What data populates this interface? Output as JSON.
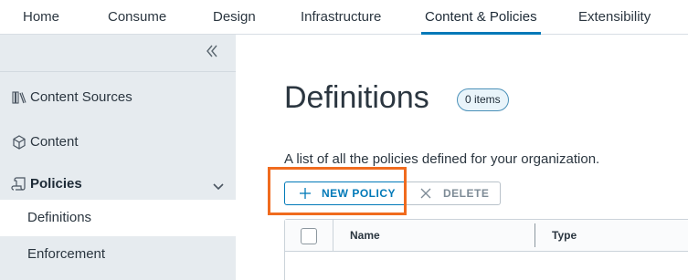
{
  "topnav": {
    "tabs": [
      {
        "label": "Home"
      },
      {
        "label": "Consume"
      },
      {
        "label": "Design"
      },
      {
        "label": "Infrastructure"
      },
      {
        "label": "Content & Policies"
      },
      {
        "label": "Extensibility"
      }
    ],
    "active_tab": "Content & Policies",
    "accent_color": "#0079b8"
  },
  "sidebar": {
    "items": [
      {
        "label": "Content Sources",
        "icon": "library-icon"
      },
      {
        "label": "Content",
        "icon": "box-icon"
      },
      {
        "label": "Policies",
        "icon": "scroll-icon",
        "expanded": true
      }
    ],
    "subitems": [
      {
        "label": "Definitions",
        "active": true
      },
      {
        "label": "Enforcement"
      }
    ]
  },
  "main": {
    "title": "Definitions",
    "count_badge": "0 items",
    "description": "A list of all the policies defined for your organization.",
    "actions": {
      "new_label": "NEW POLICY",
      "delete_label": "DELETE"
    },
    "grid": {
      "columns": [
        "Name",
        "Type"
      ]
    },
    "highlight_color": "#f06b1e"
  }
}
